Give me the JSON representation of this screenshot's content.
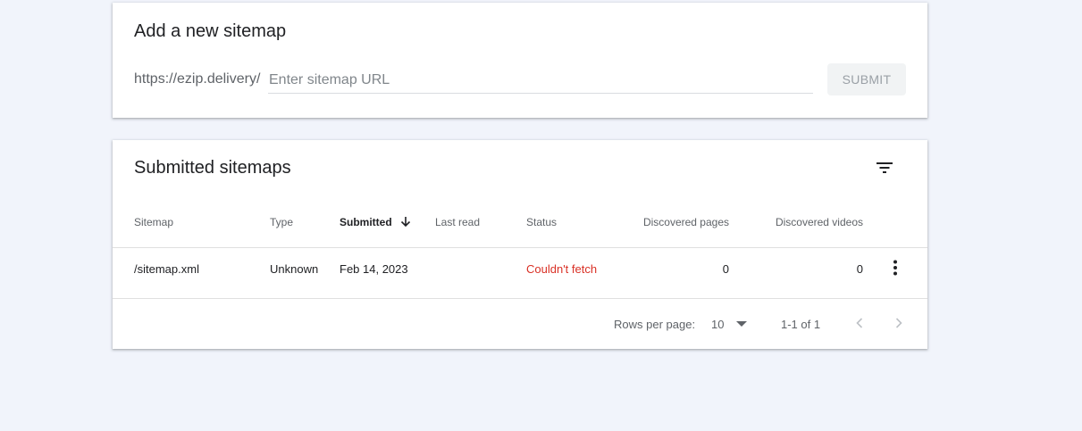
{
  "add_sitemap": {
    "title": "Add a new sitemap",
    "url_prefix": "https://ezip.delivery/",
    "input_value": "",
    "input_placeholder": "Enter sitemap URL",
    "submit_label": "SUBMIT"
  },
  "submitted": {
    "title": "Submitted sitemaps",
    "columns": {
      "sitemap": "Sitemap",
      "type": "Type",
      "submitted": "Submitted",
      "last_read": "Last read",
      "status": "Status",
      "discovered_pages": "Discovered pages",
      "discovered_videos": "Discovered videos"
    },
    "rows": [
      {
        "sitemap": "/sitemap.xml",
        "type": "Unknown",
        "submitted": "Feb 14, 2023",
        "last_read": "",
        "status": "Couldn't fetch",
        "discovered_pages": "0",
        "discovered_videos": "0"
      }
    ],
    "footer": {
      "rows_per_page_label": "Rows per page:",
      "rows_per_page_value": "10",
      "range": "1-1 of 1"
    }
  },
  "icons": {
    "filter": "filter-icon",
    "sort": "arrow-downward-icon",
    "more": "more-vert-icon",
    "dropdown": "arrow-drop-down-icon",
    "prev": "chevron-left-icon",
    "next": "chevron-right-icon"
  },
  "colors": {
    "page_background": "#f1f4fb",
    "card_background": "#ffffff",
    "error_status": "#d93025",
    "muted_text": "#5f6368"
  }
}
